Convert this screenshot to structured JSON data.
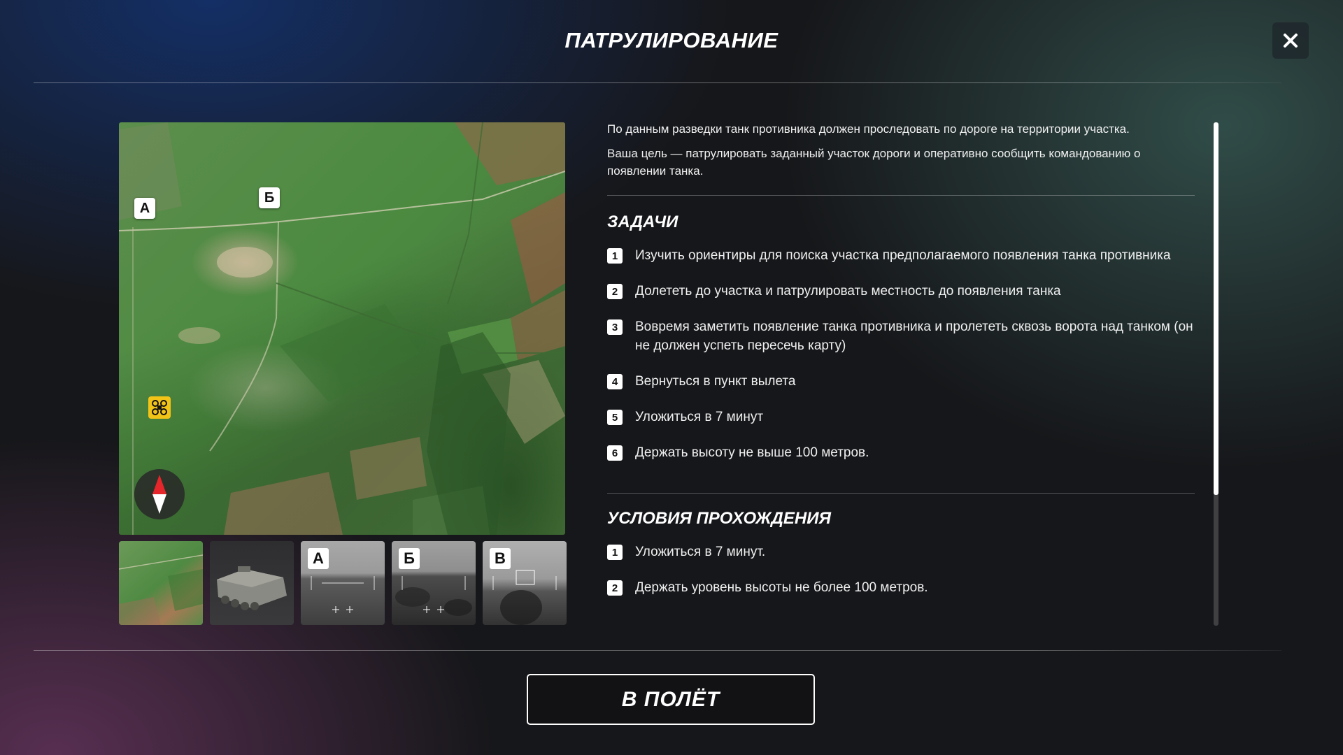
{
  "header": {
    "title": "ПАТРУЛИРОВАНИЕ"
  },
  "map": {
    "pins": [
      "А",
      "Б"
    ],
    "drone_icon": "drone-icon",
    "compass_icon": "compass-icon"
  },
  "thumbnails": [
    {
      "kind": "map",
      "tag": ""
    },
    {
      "kind": "vehicle",
      "tag": ""
    },
    {
      "kind": "camera",
      "tag": "А"
    },
    {
      "kind": "camera",
      "tag": "Б"
    },
    {
      "kind": "camera",
      "tag": "В"
    }
  ],
  "briefing": {
    "intro": [
      "По данным разведки танк противника должен проследовать по дороге на территории участка.",
      "Ваша цель — патрулировать заданный участок дороги и оперативно сообщить командованию о появлении танка."
    ],
    "tasks_title": "ЗАДАЧИ",
    "tasks": [
      {
        "num": "1",
        "text": "Изучить ориентиры для поиска участка предполагаемого появления танка противника"
      },
      {
        "num": "2",
        "text": "Долететь до участка и патрулировать местность до появления танка"
      },
      {
        "num": "3",
        "text": "Вовремя заметить появление танка противника и пролететь сквозь ворота над танком (он не должен успеть пересечь карту)"
      },
      {
        "num": "4",
        "text": "Вернуться в пункт вылета"
      },
      {
        "num": "5",
        "text": "Уложиться в 7 минут"
      },
      {
        "num": "6",
        "text": "Держать высоту не выше 100 метров."
      }
    ],
    "conditions_title": "УСЛОВИЯ ПРОХОЖДЕНИЯ",
    "conditions": [
      {
        "num": "1",
        "text": "Уложиться в 7 минут."
      },
      {
        "num": "2",
        "text": "Держать уровень высоты не более 100 метров."
      }
    ]
  },
  "scroll": {
    "visible_fraction": 0.74
  },
  "footer": {
    "fly_label": "В ПОЛЁТ"
  },
  "colors": {
    "accent_yellow": "#f2c417",
    "compass_red": "#e5262b"
  }
}
